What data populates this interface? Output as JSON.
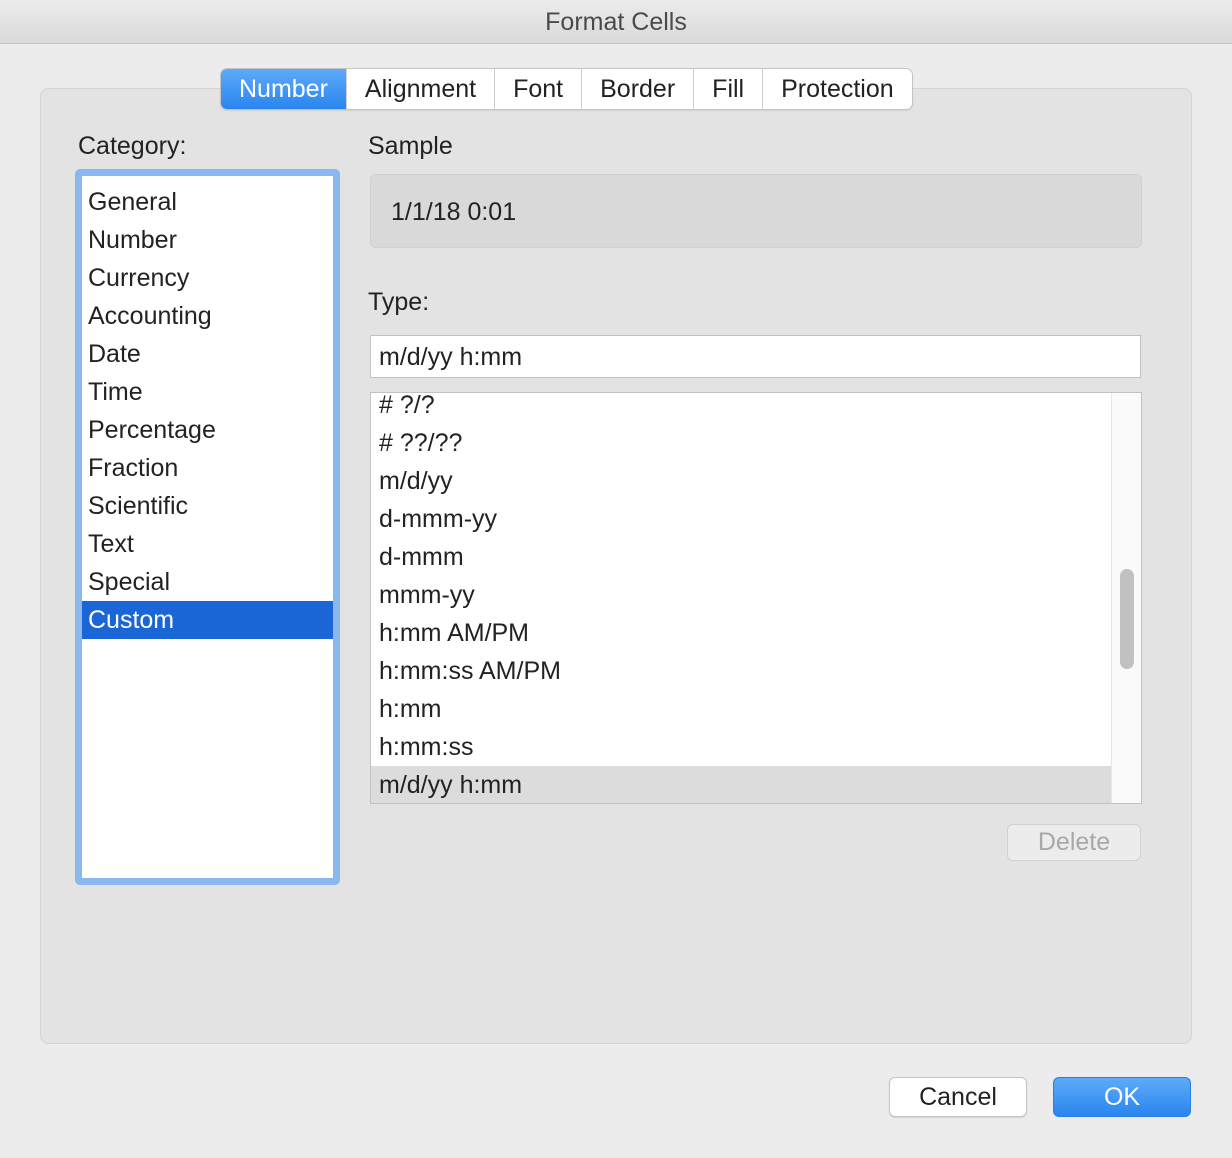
{
  "window": {
    "title": "Format Cells"
  },
  "tabs": [
    {
      "label": "Number",
      "active": true
    },
    {
      "label": "Alignment",
      "active": false
    },
    {
      "label": "Font",
      "active": false
    },
    {
      "label": "Border",
      "active": false
    },
    {
      "label": "Fill",
      "active": false
    },
    {
      "label": "Protection",
      "active": false
    }
  ],
  "category": {
    "label": "Category:",
    "selected": "Custom",
    "items": [
      "General",
      "Number",
      "Currency",
      "Accounting",
      "Date",
      "Time",
      "Percentage",
      "Fraction",
      "Scientific",
      "Text",
      "Special",
      "Custom"
    ]
  },
  "sample": {
    "label": "Sample",
    "value": "1/1/18 0:01"
  },
  "type": {
    "label": "Type:",
    "value": "m/d/yy h:mm",
    "selected": "m/d/yy h:mm",
    "formats": [
      "# ?/?",
      "# ??/??",
      "m/d/yy",
      "d-mmm-yy",
      "d-mmm",
      "mmm-yy",
      "h:mm AM/PM",
      "h:mm:ss AM/PM",
      "h:mm",
      "h:mm:ss",
      "m/d/yy h:mm"
    ]
  },
  "buttons": {
    "delete": "Delete",
    "cancel": "Cancel",
    "ok": "OK"
  },
  "colors": {
    "accent": "#2a85ef",
    "selection": "#1a66d6",
    "focus_ring": "#8ab8ee"
  }
}
